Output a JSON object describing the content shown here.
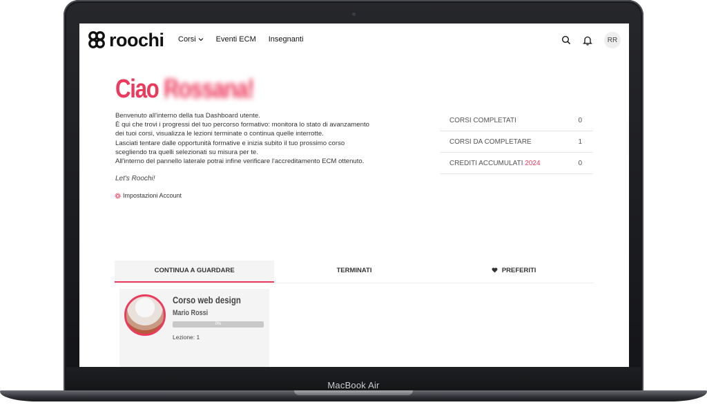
{
  "header": {
    "logo_text": "roochi",
    "nav": [
      {
        "label": "Corsi"
      },
      {
        "label": "Eventi ECM"
      },
      {
        "label": "Insegnanti"
      }
    ],
    "avatar_initials": "RR"
  },
  "greeting": {
    "hello": "Ciao",
    "name": "Rossana!"
  },
  "intro_lines": [
    "Benvenuto all'interno della tua Dashboard utente.",
    "È qui che trovi i progressi del tuo percorso formativo: monitora lo stato di avanzamento",
    "dei tuoi corsi, visualizza le lezioni terminate o continua quelle interrotte.",
    "Lasciati tentare dalle opportunità formative e inizia subito il tuo prossimo corso",
    "scegliendo tra quelli selezionati su misura per te.",
    "All'interno del pannello laterale potrai infine verificare l'accreditamento ECM ottenuto."
  ],
  "slogan": "Let's Roochi!",
  "settings_link": "Impostazioni Account",
  "stats": [
    {
      "label": "CORSI COMPLETATI",
      "accent": "",
      "value": "0"
    },
    {
      "label": "CORSI DA COMPLETARE",
      "accent": "",
      "value": "1"
    },
    {
      "label": "CREDITI ACCUMULATI ",
      "accent": "2024",
      "value": "0"
    }
  ],
  "tabs": [
    {
      "label": "CONTINUA A GUARDARE",
      "active": true
    },
    {
      "label": "TERMINATI",
      "active": false
    },
    {
      "label": "PREFERITI",
      "active": false
    }
  ],
  "course": {
    "title": "Corso web design",
    "author": "Mario Rossi",
    "progress_label": "0%",
    "progress": 0,
    "lesson": "Lezione: 1"
  },
  "device": {
    "label": "MacBook Air"
  },
  "colors": {
    "accent": "#ec3a5c",
    "frame": "#1a1b1e"
  }
}
